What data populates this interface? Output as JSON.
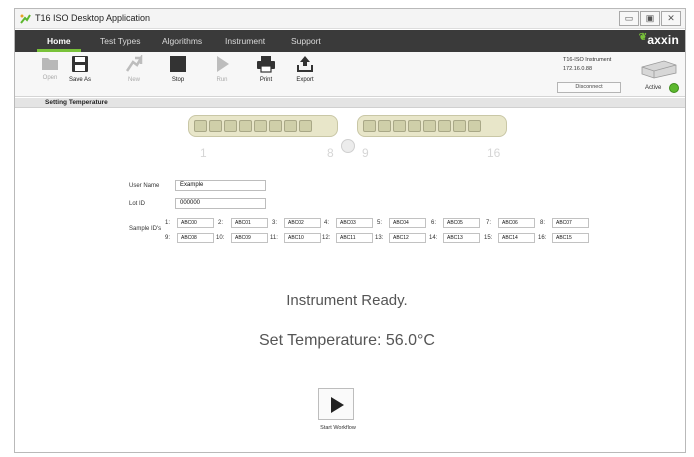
{
  "window": {
    "title": "T16 ISO Desktop Application",
    "controls": {
      "minimize": "▭",
      "maximize": "▣",
      "close": "✕"
    }
  },
  "menu": {
    "tabs": [
      {
        "label": "Home",
        "active": true
      },
      {
        "label": "Test Types",
        "active": false
      },
      {
        "label": "Algorithms",
        "active": false
      },
      {
        "label": "Instrument",
        "active": false
      },
      {
        "label": "Support",
        "active": false
      }
    ],
    "logo_text": "axxin"
  },
  "toolbar": {
    "open_label": "Open",
    "save_as_label": "Save As",
    "new_label": "New",
    "stop_label": "Stop",
    "run_label": "Run",
    "print_label": "Print",
    "export_label": "Export"
  },
  "instrument": {
    "name": "T16-ISO Instrument",
    "ip": "172.16.0.88",
    "disconnect_label": "Disconnect",
    "status_label": "Active",
    "status_color": "#5cb82e"
  },
  "status": {
    "text": "Setting Temperature"
  },
  "strips": {
    "labels": [
      "1",
      "8",
      "9",
      "16"
    ]
  },
  "form": {
    "user_name_label": "User Name",
    "user_name_value": "Example",
    "lot_id_label": "Lot ID",
    "lot_id_value": "000000",
    "sample_ids_label": "Sample ID's",
    "sample_ids": [
      {
        "num": "1:",
        "value": "ABC00"
      },
      {
        "num": "2:",
        "value": "ABC01"
      },
      {
        "num": "3:",
        "value": "ABC02"
      },
      {
        "num": "4:",
        "value": "ABC03"
      },
      {
        "num": "5:",
        "value": "ABC04"
      },
      {
        "num": "6:",
        "value": "ABC05"
      },
      {
        "num": "7:",
        "value": "ABC06"
      },
      {
        "num": "8:",
        "value": "ABC07"
      },
      {
        "num": "9:",
        "value": "ABC08"
      },
      {
        "num": "10:",
        "value": "ABC09"
      },
      {
        "num": "11:",
        "value": "ABC10"
      },
      {
        "num": "12:",
        "value": "ABC11"
      },
      {
        "num": "13:",
        "value": "ABC12"
      },
      {
        "num": "14:",
        "value": "ABC13"
      },
      {
        "num": "15:",
        "value": "ABC14"
      },
      {
        "num": "16:",
        "value": "ABC15"
      }
    ]
  },
  "main": {
    "ready_text": "Instrument Ready.",
    "temperature_text": "Set Temperature: 56.0°C",
    "start_label": "Start Workflow"
  }
}
